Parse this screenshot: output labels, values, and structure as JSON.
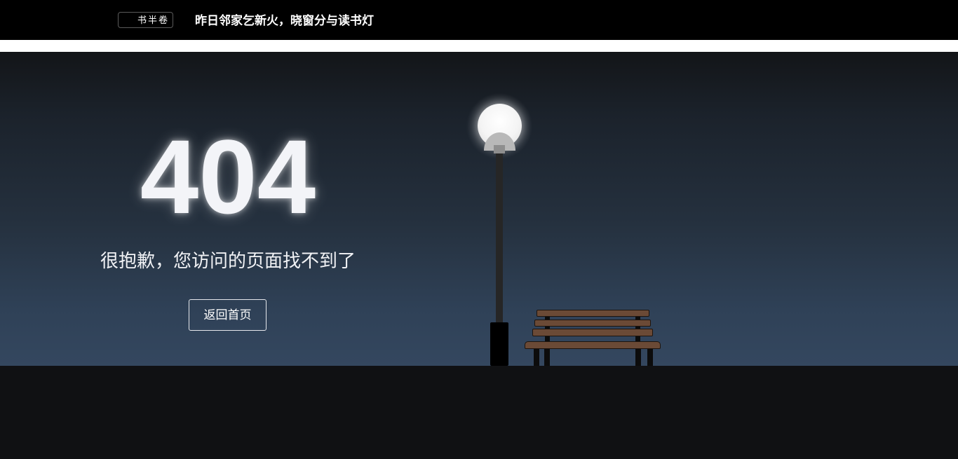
{
  "header": {
    "logo_label": "书半卷",
    "slogan": "昨日邻家乞新火，晓窗分与读书灯"
  },
  "error": {
    "code": "404",
    "message": "很抱歉，您访问的页面找不到了",
    "home_button_label": "返回首页"
  },
  "colors": {
    "topbar": "#000000",
    "sky_top": "#131518",
    "sky_bottom": "#34475f",
    "ground": "#101113",
    "bench_wood": "#6b4a36"
  }
}
